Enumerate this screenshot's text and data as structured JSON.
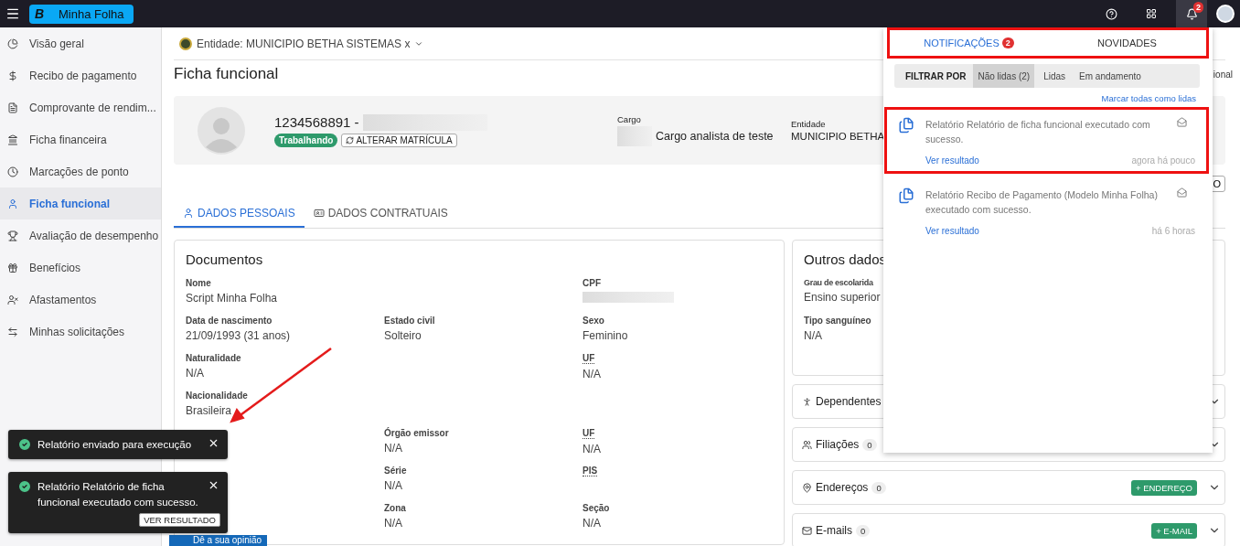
{
  "topbar": {
    "logo_letter": "B",
    "app_name": "Minha Folha",
    "notification_count": "2"
  },
  "sidebar": {
    "items": [
      {
        "label": "Visão geral",
        "selected": false
      },
      {
        "label": "Recibo de pagamento",
        "selected": false
      },
      {
        "label": "Comprovante de rendim...",
        "selected": false
      },
      {
        "label": "Ficha financeira",
        "selected": false
      },
      {
        "label": "Marcações de ponto",
        "selected": false
      },
      {
        "label": "Ficha funcional",
        "selected": true
      },
      {
        "label": "Avaliação de desempenho",
        "selected": false
      },
      {
        "label": "Benefícios",
        "selected": false
      },
      {
        "label": "Afastamentos",
        "selected": false
      },
      {
        "label": "Minhas solicitações",
        "selected": false
      }
    ]
  },
  "entity": "Entidade: MUNICIPIO BETHA SISTEMAS x",
  "page_title": "Ficha funcional",
  "breadcrumb_fragment": "ional",
  "profile": {
    "registration": "1234568891 -",
    "status": "Trabalhando",
    "change_button": "ALTERAR MATRÍCULA",
    "fields": [
      {
        "label": "Cargo",
        "value": "Cargo analista de teste",
        "redacted": true
      },
      {
        "label": "Entidade",
        "value": "MUNICIPIO BETHA"
      }
    ]
  },
  "side_button": "O",
  "tabs": [
    {
      "label": "DADOS PESSOAIS",
      "selected": true
    },
    {
      "label": "DADOS CONTRATUAIS",
      "selected": false
    }
  ],
  "documents": {
    "title": "Documentos",
    "rows": [
      [
        {
          "label": "Nome",
          "value": "Script Minha Folha"
        },
        null,
        {
          "label": "CPF",
          "redacted": true
        }
      ],
      [
        {
          "label": "Data de nascimento",
          "value": "21/09/1993 (31 anos)"
        },
        {
          "label": "Estado civil",
          "value": "Solteiro"
        },
        {
          "label": "Sexo",
          "value": "Feminino"
        }
      ],
      [
        {
          "label": "Naturalidade",
          "value": "N/A"
        },
        null,
        {
          "label": "UF",
          "value": "N/A",
          "abbr": true
        }
      ],
      [
        {
          "label": "Nacionalidade",
          "value": "Brasileira"
        },
        null,
        null
      ],
      [
        null,
        {
          "label": "Órgão emissor",
          "value": "N/A"
        },
        {
          "label": "UF",
          "value": "N/A",
          "abbr": true
        }
      ],
      [
        null,
        {
          "label": "Série",
          "value": "N/A"
        },
        {
          "label": "PIS",
          "abbr": true
        }
      ],
      [
        null,
        {
          "label": "Zona",
          "value": "N/A"
        },
        {
          "label": "Seção",
          "value": "N/A"
        }
      ]
    ]
  },
  "other_data": {
    "title": "Outros dados",
    "fields": [
      {
        "label": "Grau de escolarida",
        "value": "Ensino superior"
      },
      {
        "label": "Tipo sanguíneo",
        "value": "N/A"
      }
    ]
  },
  "sections": [
    {
      "label": "Dependentes"
    },
    {
      "label": "Filiações",
      "count": "0"
    },
    {
      "label": "Endereços",
      "count": "0",
      "action": "+ ENDEREÇO"
    },
    {
      "label": "E-mails",
      "count": "0",
      "action": "+ E-MAIL"
    }
  ],
  "notifications": {
    "tabs_highlighted": true,
    "tabs": [
      {
        "label": "NOTIFICAÇÕES",
        "count": "2",
        "selected": true
      },
      {
        "label": "NOVIDADES",
        "selected": false
      }
    ],
    "filter_label": "FILTRAR POR",
    "filters": [
      {
        "label": "Não lidas (2)",
        "selected": true
      },
      {
        "label": "Lidas",
        "selected": false
      },
      {
        "label": "Em andamento",
        "selected": false
      }
    ],
    "mark_all": "Marcar todas como lidas",
    "items": [
      {
        "text": "Relatório Relatório de ficha funcional executado com sucesso.",
        "link": "Ver resultado",
        "time": "agora há pouco",
        "highlighted": true
      },
      {
        "text": "Relatório Recibo de Pagamento (Modelo Minha Folha) executado com sucesso.",
        "link": "Ver resultado",
        "time": "há 6 horas",
        "highlighted": false
      }
    ]
  },
  "toasts": [
    {
      "text": "Relatório enviado para execução"
    },
    {
      "text": "Relatório Relatório de ficha funcional executado com sucesso.",
      "action": "VER RESULTADO"
    }
  ],
  "feedback_button": "Dê a sua opinião"
}
